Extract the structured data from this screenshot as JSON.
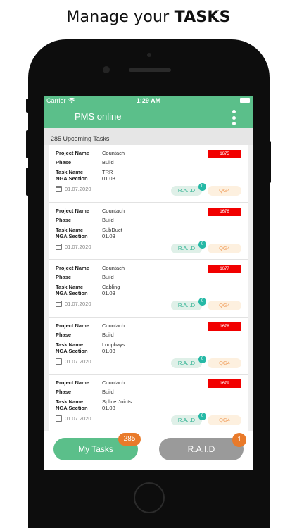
{
  "headline": {
    "prefix": "Manage your ",
    "bold": "TASKS"
  },
  "status_bar": {
    "carrier": "Carrier",
    "time": "1:29 AM"
  },
  "app_bar": {
    "title": "PMS online"
  },
  "upcoming_label": "285 Upcoming Tasks",
  "labels": {
    "project_name": "Project Name",
    "phase": "Phase",
    "task_name": "Task Name",
    "nga_section": "NGA Section"
  },
  "tasks": [
    {
      "id": "1675",
      "project": "Countach",
      "phase": "Build",
      "task": "TRR",
      "section": "01.03",
      "date": "01.07.2020",
      "raid": "R.A.I.D",
      "raid_count": "0",
      "qg": "QG4"
    },
    {
      "id": "1676",
      "project": "Countach",
      "phase": "Build",
      "task": "SubDuct",
      "section": "01.03",
      "date": "01.07.2020",
      "raid": "R.A.I.D",
      "raid_count": "0",
      "qg": "QG4"
    },
    {
      "id": "1677",
      "project": "Countach",
      "phase": "Build",
      "task": "Cabling",
      "section": "01.03",
      "date": "01.07.2020",
      "raid": "R.A.I.D",
      "raid_count": "0",
      "qg": "QG4"
    },
    {
      "id": "1678",
      "project": "Countach",
      "phase": "Build",
      "task": "Loopbays",
      "section": "01.03",
      "date": "01.07.2020",
      "raid": "R.A.I.D",
      "raid_count": "0",
      "qg": "QG4"
    },
    {
      "id": "1679",
      "project": "Countach",
      "phase": "Build",
      "task": "Splice Joints",
      "section": "01.03",
      "date": "01.07.2020",
      "raid": "R.A.I.D",
      "raid_count": "0",
      "qg": "QG4"
    }
  ],
  "bottom": {
    "my_tasks": "My Tasks",
    "my_tasks_count": "285",
    "raid": "R.A.I.D",
    "raid_count": "1"
  },
  "colors": {
    "accent": "#5bbf8a",
    "badge_red": "#f10000",
    "count_orange": "#e97a2a",
    "raid_teal": "#26b9a6"
  },
  "icons": [
    "wifi-icon",
    "battery-icon",
    "kebab-menu-icon",
    "calendar-icon"
  ]
}
